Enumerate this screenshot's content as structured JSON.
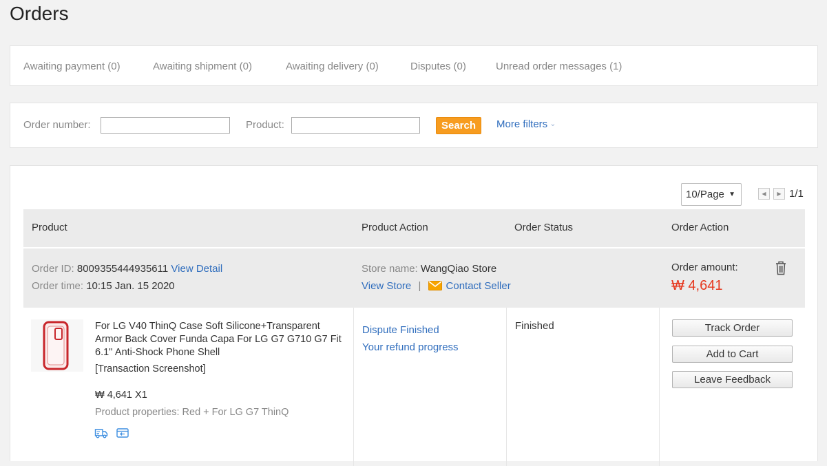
{
  "page": {
    "title": "Orders"
  },
  "tabs": [
    {
      "label": "Awaiting payment (0)"
    },
    {
      "label": "Awaiting shipment (0)"
    },
    {
      "label": "Awaiting delivery (0)"
    },
    {
      "label": "Disputes (0)"
    },
    {
      "label": "Unread order messages (1)"
    }
  ],
  "filters": {
    "order_number_label": "Order number:",
    "order_number_value": "",
    "product_label": "Product:",
    "product_value": "",
    "search_label": "Search",
    "more_filters_label": "More filters"
  },
  "pager": {
    "page_size": "10/Page",
    "page_count": "1/1"
  },
  "table": {
    "headers": {
      "product": "Product",
      "product_action": "Product Action",
      "order_status": "Order Status",
      "order_action": "Order Action"
    }
  },
  "order": {
    "id_label": "Order ID:",
    "id_value": "8009355444935611",
    "view_detail": "View Detail",
    "time_label": "Order time:",
    "time_value": "10:15 Jan. 15 2020",
    "store_label": "Store name:",
    "store_value": "WangQiao Store",
    "view_store": "View Store",
    "separator": "|",
    "contact_seller": "Contact Seller",
    "amount_label": "Order amount:",
    "amount_value": "₩ 4,641",
    "item": {
      "title": "For LG V40 ThinQ Case Soft Silicone+Transparent Armor Back Cover Funda Capa For LG G7 G710 G7 Fit 6.1'' Anti-Shock Phone Shell",
      "snapshot": "[Transaction Screenshot]",
      "price_qty": "₩ 4,641 X1",
      "properties": "Product properties: Red + For LG G7 ThinQ"
    },
    "product_actions": {
      "dispute": "Dispute Finished",
      "refund": "Your refund progress"
    },
    "status": "Finished",
    "actions": {
      "track": "Track Order",
      "add_cart": "Add to Cart",
      "feedback": "Leave Feedback"
    }
  },
  "colors": {
    "accent_orange": "#f79c1f",
    "link_blue": "#2f6dbd",
    "price_red": "#e6381f"
  },
  "icons": [
    "trash-icon",
    "mail-icon",
    "truck-icon",
    "return-icon",
    "chevron-down-icon",
    "page-prev-icon",
    "page-next-icon"
  ]
}
